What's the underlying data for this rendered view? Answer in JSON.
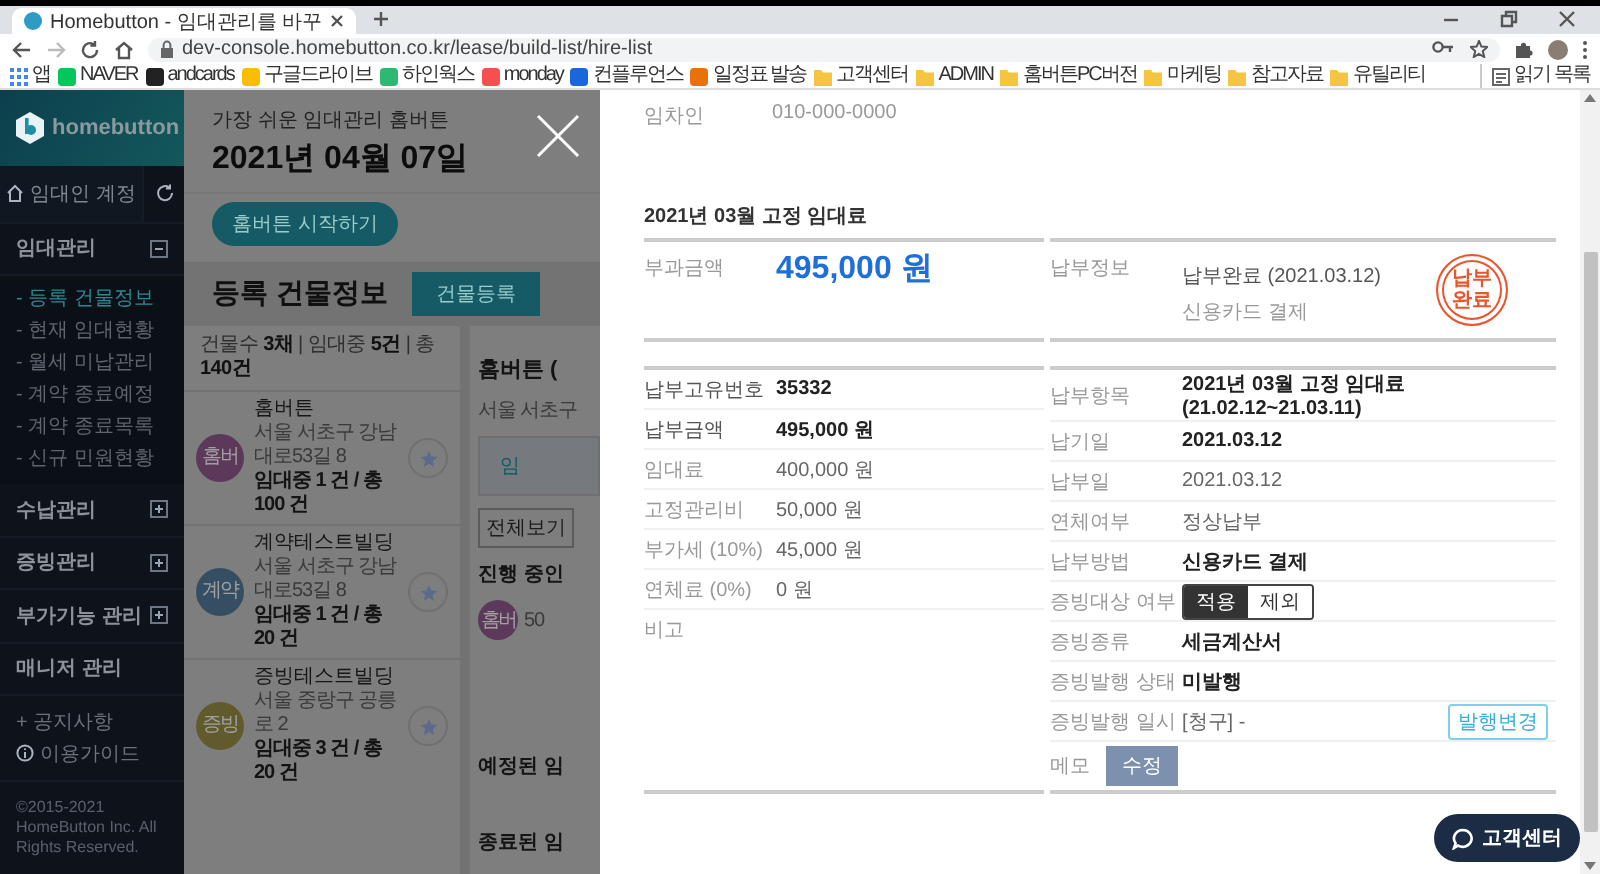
{
  "browser": {
    "tab_title": "Homebutton - 임대관리를 바꾸",
    "url": "dev-console.homebutton.co.kr/lease/build-list/hire-list",
    "bookmarks": [
      {
        "label": "앱",
        "kind": "apps"
      },
      {
        "label": "NAVER",
        "kind": "site",
        "color": "#03c75a"
      },
      {
        "label": "andcards",
        "kind": "site",
        "color": "#222222"
      },
      {
        "label": "구글드라이브",
        "kind": "site",
        "color": "#fbbc04"
      },
      {
        "label": "하인웍스",
        "kind": "site",
        "color": "#2eb872"
      },
      {
        "label": "monday",
        "kind": "site",
        "color": "#f64f4f"
      },
      {
        "label": "컨플루언스",
        "kind": "site",
        "color": "#1868db"
      },
      {
        "label": "일정표 발송",
        "kind": "site",
        "color": "#e8710a"
      },
      {
        "label": "고객센터",
        "kind": "folder"
      },
      {
        "label": "ADMIN",
        "kind": "folder"
      },
      {
        "label": "홈버튼PC버전",
        "kind": "folder"
      },
      {
        "label": "마케팅",
        "kind": "folder"
      },
      {
        "label": "참고자료",
        "kind": "folder"
      },
      {
        "label": "유틸리티",
        "kind": "folder"
      }
    ],
    "reading_list": "읽기 목록"
  },
  "sidebar": {
    "logo": "homebutton",
    "account": "임대인 계정",
    "sections": [
      {
        "kind": "group",
        "label": "임대관리",
        "expanded": true,
        "children": [
          {
            "label": "- 등록 건물정보",
            "selected": true
          },
          {
            "label": "- 현재 임대현황",
            "selected": false
          },
          {
            "label": "- 월세 미납관리",
            "selected": false
          },
          {
            "label": "- 계약 종료예정",
            "selected": false
          },
          {
            "label": "- 계약 종료목록",
            "selected": false
          },
          {
            "label": "- 신규 민원현황",
            "selected": false
          }
        ]
      },
      {
        "kind": "group",
        "label": "수납관리",
        "expanded": false
      },
      {
        "kind": "group",
        "label": "증빙관리",
        "expanded": false
      },
      {
        "kind": "group",
        "label": "부가기능 관리",
        "expanded": false
      },
      {
        "kind": "link",
        "label": "매니저 관리"
      }
    ],
    "notice_link": "+ 공지사항",
    "guide_link": "이용가이드",
    "copyright": "©2015-2021 HomeButton Inc. All Rights Reserved."
  },
  "main": {
    "subtitle": "가장 쉬운 임대관리 홈버튼",
    "date": "2021년 04월 07일",
    "start_button": "홈버튼 시작하기",
    "section_title": "등록 건물정보",
    "register_button": "건물등록",
    "summary": "건물수 **3채** | 임대중 **5건** | 총 **140건**",
    "buildings": [
      {
        "badge": "홈버",
        "color": "#5c385a",
        "name": "홈버튼",
        "address": "서울 서초구 강남대로53길 8",
        "count": "임대중 1 건 / 총 100 건"
      },
      {
        "badge": "계약",
        "color": "#364e63",
        "name": "계약테스트빌딩",
        "address": "서울 서초구 강남대로53길 8",
        "count": "임대중 1 건 / 총 20 건"
      },
      {
        "badge": "증빙",
        "color": "#615a2d",
        "name": "증빙테스트빌딩",
        "address": "서울 중랑구 공릉로 2",
        "count": "임대중 3 건 / 총 20 건"
      }
    ],
    "peek": {
      "title": "홈버튼 (",
      "address": "서울 서초구",
      "tab": "임",
      "filter": "전체보기",
      "ongoing": "진행 중인",
      "badge": {
        "label": "홈버",
        "color": "#5c385a"
      },
      "contract": "50",
      "scheduled": "예정된 임",
      "ended": "종료된 임"
    }
  },
  "drawer": {
    "tenant_label": "임차인",
    "tenant_phone": "010-000-0000",
    "bill_title": "2021년 03월 고정 임대료",
    "charge": {
      "label": "부과금액",
      "amount": "495,000 원"
    },
    "payment_info": {
      "label": "납부정보",
      "status": "납부완료 (2021.03.12)",
      "method": "신용카드 결제",
      "stamp": "납부 완료"
    },
    "left_rows": [
      {
        "label": "납부고유번호",
        "value": "35332",
        "emphasis": true
      },
      {
        "label": "납부금액",
        "value": "495,000 원",
        "emphasis": true
      },
      {
        "label": "임대료",
        "value": "400,000 원",
        "emphasis": false
      },
      {
        "label": "고정관리비",
        "value": "50,000 원",
        "emphasis": false
      },
      {
        "label": "부가세 (10%)",
        "value": "45,000 원",
        "emphasis": false
      },
      {
        "label": "연체료 (0%)",
        "value": "0 원",
        "emphasis": false
      },
      {
        "label": "비고",
        "emphasis": false
      }
    ],
    "right_rows": [
      {
        "kind": "text",
        "label": "납부항목",
        "value": "2021년 03월 고정 임대료 (21.02.12~21.03.11)",
        "emphasis": true
      },
      {
        "kind": "text",
        "label": "납기일",
        "value": "2021.03.12",
        "emphasis": true
      },
      {
        "kind": "text",
        "label": "납부일",
        "value": "2021.03.12",
        "emphasis": false
      },
      {
        "kind": "text",
        "label": "연체여부",
        "value": "정상납부",
        "emphasis": false
      },
      {
        "kind": "text",
        "label": "납부방법",
        "value": "신용카드 결제",
        "emphasis": true
      },
      {
        "kind": "toggle",
        "label": "증빙대상 여부",
        "options": [
          {
            "label": "적용",
            "selected": true
          },
          {
            "label": "제외",
            "selected": false
          }
        ]
      },
      {
        "kind": "text",
        "label": "증빙종류",
        "value": "세금계산서",
        "emphasis": true
      },
      {
        "kind": "text",
        "label": "증빙발행 상태",
        "value": "미발행",
        "emphasis": true
      },
      {
        "kind": "action",
        "label": "증빙발행 일시",
        "value": "[청구] -",
        "button": "발행변경"
      },
      {
        "kind": "button",
        "label": "메모",
        "button": "수정"
      }
    ],
    "chat_button": "고객센터"
  }
}
